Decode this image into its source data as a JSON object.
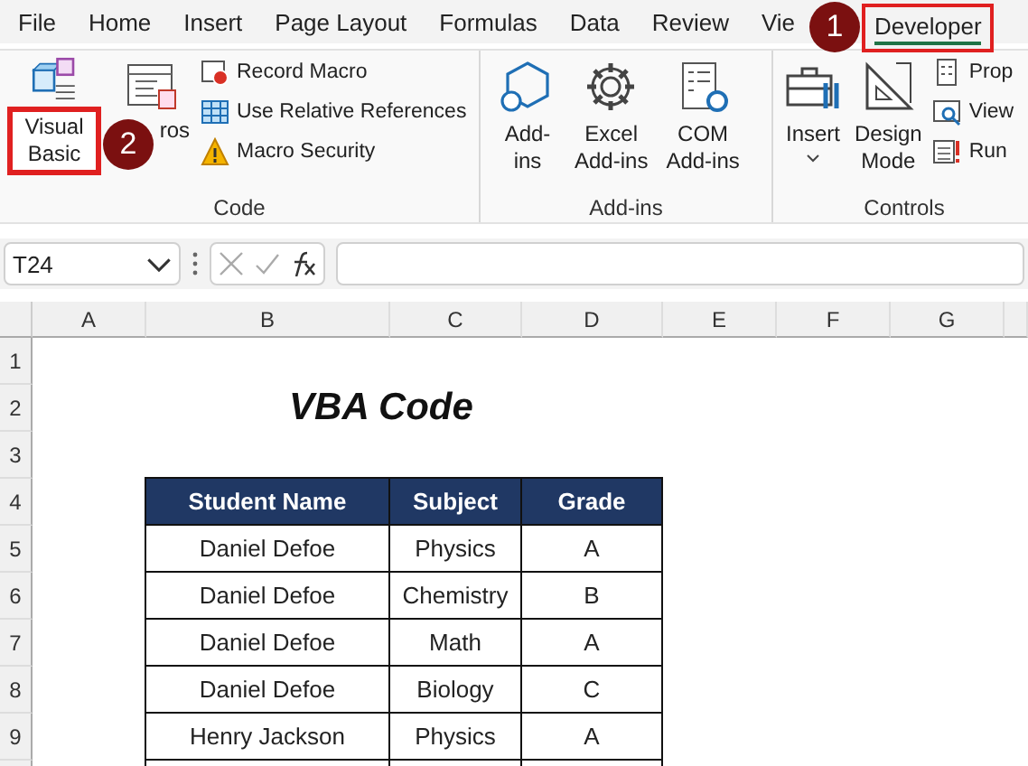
{
  "tabs": [
    {
      "label": "File",
      "selected": false
    },
    {
      "label": "Home",
      "selected": false
    },
    {
      "label": "Insert",
      "selected": false
    },
    {
      "label": "Page Layout",
      "selected": false
    },
    {
      "label": "Formulas",
      "selected": false
    },
    {
      "label": "Data",
      "selected": false
    },
    {
      "label": "Review",
      "selected": false
    },
    {
      "label": "Vie",
      "selected": false
    },
    {
      "label": "Developer",
      "selected": true,
      "callout": "1"
    }
  ],
  "ribbon": {
    "groups": [
      {
        "label": "Code",
        "items": [
          {
            "kind": "large",
            "label": "Visual Basic",
            "callout": "2"
          },
          {
            "kind": "large",
            "label": "ros"
          },
          {
            "kind": "stack",
            "items": [
              {
                "label": "Record Macro"
              },
              {
                "label": "Use Relative References"
              },
              {
                "label": "Macro Security"
              }
            ]
          }
        ]
      },
      {
        "label": "Add-ins",
        "items": [
          {
            "kind": "large",
            "label": "Add-ins"
          },
          {
            "kind": "large",
            "label": "Excel Add-ins"
          },
          {
            "kind": "large",
            "label": "COM Add-ins"
          }
        ]
      },
      {
        "label": "Controls",
        "items": [
          {
            "kind": "large",
            "label": "Insert",
            "dropdown": true
          },
          {
            "kind": "large",
            "label": "Design Mode"
          },
          {
            "kind": "stack",
            "items": [
              {
                "label": "Prop"
              },
              {
                "label": "View"
              },
              {
                "label": "Run"
              }
            ]
          }
        ]
      }
    ]
  },
  "formula_bar": {
    "name_box": "T24"
  },
  "sheet": {
    "columns": [
      "A",
      "B",
      "C",
      "D",
      "E",
      "F",
      "G"
    ],
    "rows": [
      "1",
      "2",
      "3",
      "4",
      "5",
      "6",
      "7",
      "8",
      "9"
    ],
    "title": "VBA Code",
    "table": {
      "columns": [
        "Student Name",
        "Subject",
        "Grade"
      ],
      "rows": [
        [
          "Daniel Defoe",
          "Physics",
          "A"
        ],
        [
          "Daniel Defoe",
          "Chemistry",
          "B"
        ],
        [
          "Daniel Defoe",
          "Math",
          "A"
        ],
        [
          "Daniel Defoe",
          "Biology",
          "C"
        ],
        [
          "Henry Jackson",
          "Physics",
          "A"
        ]
      ]
    }
  }
}
